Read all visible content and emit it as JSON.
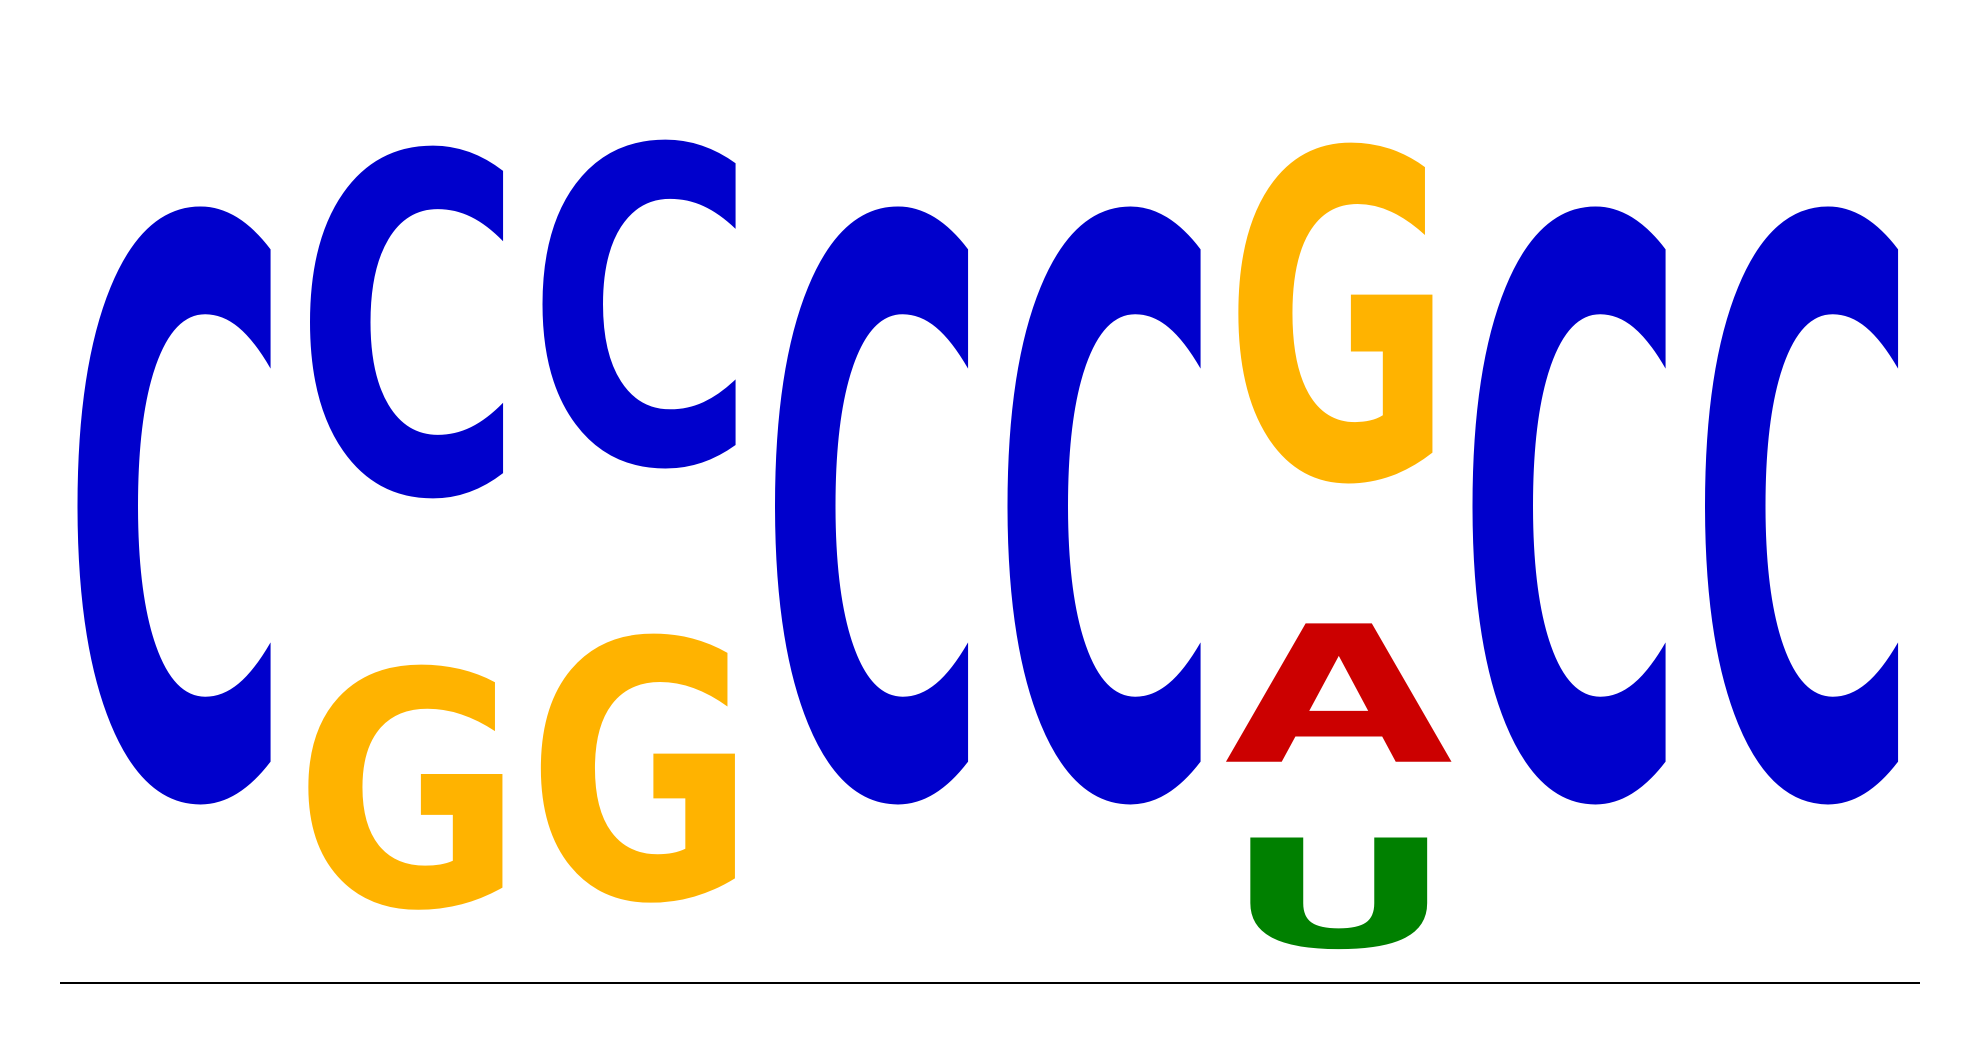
{
  "logo": {
    "alphabet_colors": {
      "C": "#0000cc",
      "G": "#ffb300",
      "A": "#cc0000",
      "U": "#008000"
    },
    "positions": [
      {
        "stack": [
          {
            "letter": "C",
            "fraction": 1.0
          }
        ]
      },
      {
        "stack": [
          {
            "letter": "G",
            "fraction": 0.41
          },
          {
            "letter": "C",
            "fraction": 0.59
          }
        ]
      },
      {
        "stack": [
          {
            "letter": "G",
            "fraction": 0.45
          },
          {
            "letter": "C",
            "fraction": 0.55
          }
        ]
      },
      {
        "stack": [
          {
            "letter": "C",
            "fraction": 1.0
          }
        ]
      },
      {
        "stack": [
          {
            "letter": "C",
            "fraction": 1.0
          }
        ]
      },
      {
        "stack": [
          {
            "letter": "U",
            "fraction": 0.19
          },
          {
            "letter": "A",
            "fraction": 0.24
          },
          {
            "letter": "G",
            "fraction": 0.57
          }
        ]
      },
      {
        "stack": [
          {
            "letter": "C",
            "fraction": 1.0
          }
        ]
      },
      {
        "stack": [
          {
            "letter": "C",
            "fraction": 1.0
          }
        ]
      }
    ]
  }
}
